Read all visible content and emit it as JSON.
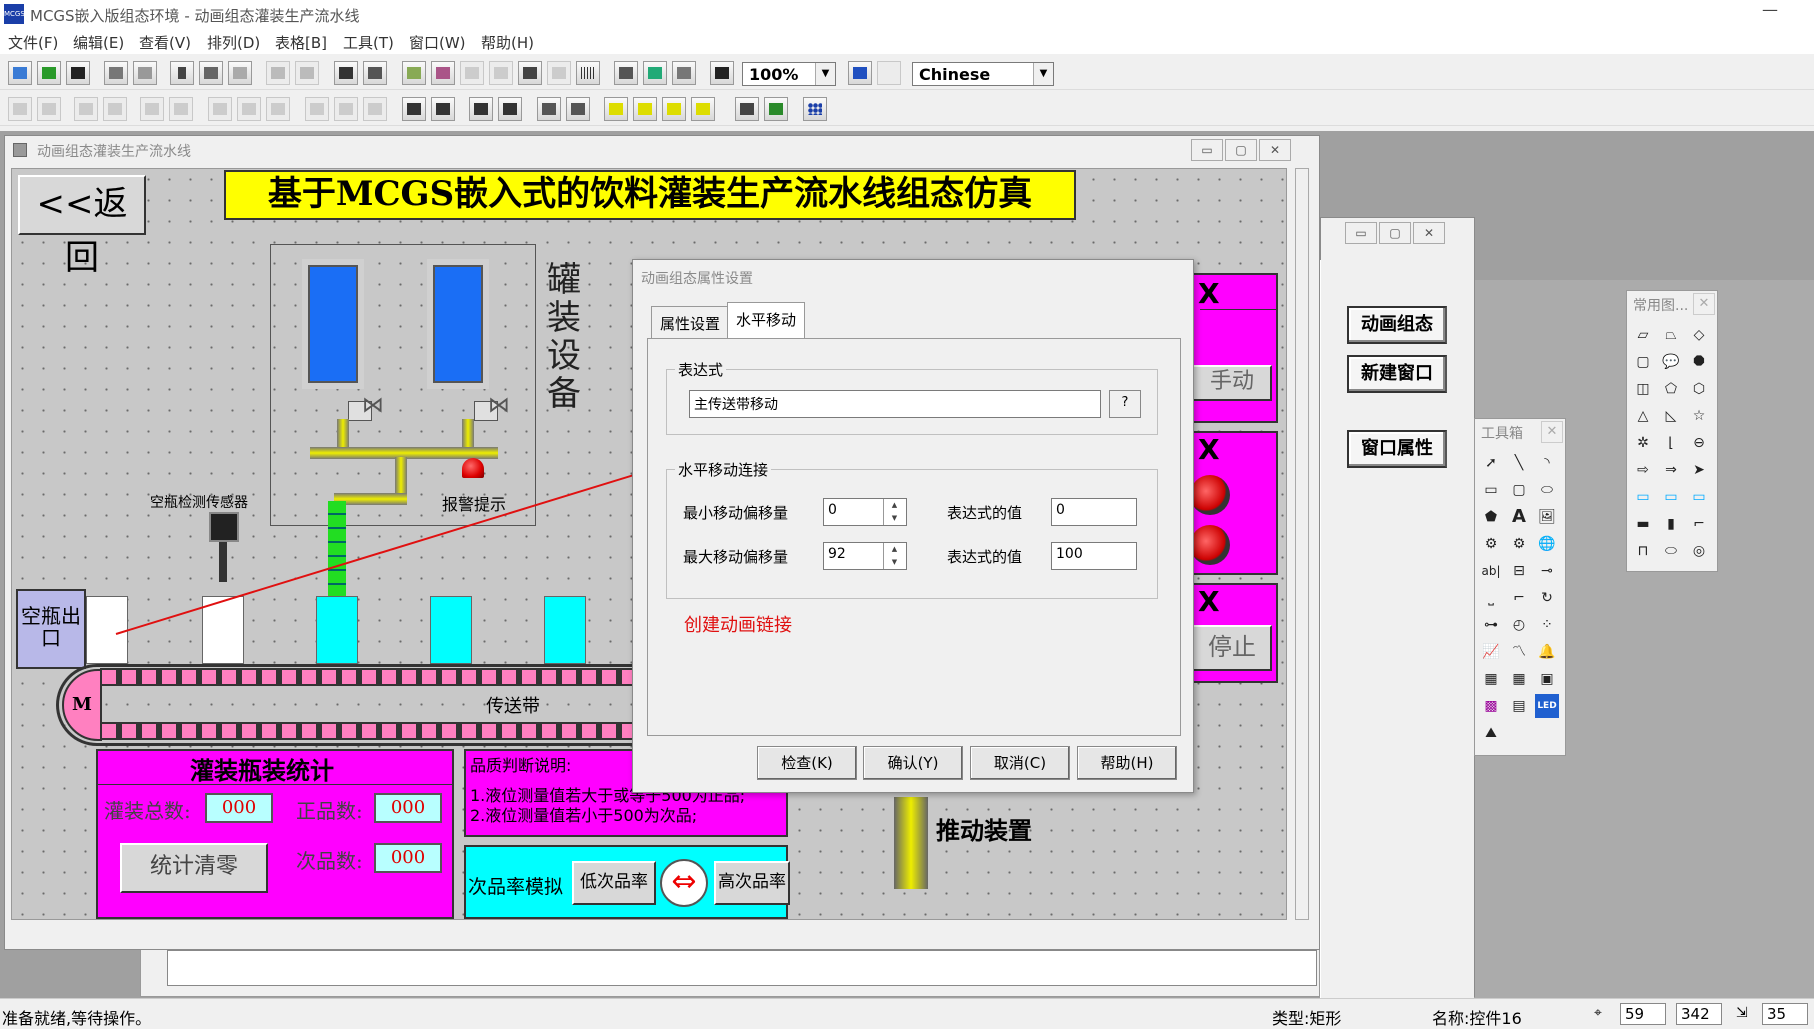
{
  "app": {
    "title": "MCGS嵌入版组态环境 - 动画组态灌装生产流水线",
    "icon_text": "MCGS"
  },
  "menu": [
    "文件(F)",
    "编辑(E)",
    "查看(V)",
    "排列(D)",
    "表格[B]",
    "工具(T)",
    "窗口(W)",
    "帮助(H)"
  ],
  "toolbar": {
    "zoom": "100%",
    "language": "Chinese"
  },
  "canvas_window": {
    "title": "动画组态灌装生产流水线",
    "back_button": "<<返回",
    "banner": "基于MCGS嵌入式的饮料灌装生产流水线组态仿真",
    "equipment_label": "罐装设备",
    "sensor_label": "空瓶检测传感器",
    "alarm_label": "报警提示",
    "empty_bottle_exit": "空瓶出口",
    "motor_label": "M",
    "conveyor_label": "传送带",
    "stats": {
      "title": "灌装瓶装统计",
      "total_label": "灌装总数:",
      "total_value": "000",
      "good_label": "正品数:",
      "good_value": "000",
      "defect_label": "次品数:",
      "defect_value": "000",
      "reset_button": "统计清零"
    },
    "quality": {
      "title": "品质判断说明:",
      "line1": "1.液位测量值若大于或等于500为正品;",
      "line2": "2.液位测量值若小于500为次品;"
    },
    "defect_sim": {
      "label": "次品率模拟",
      "low_button": "低次品率",
      "high_button": "高次品率"
    },
    "push_device": "推动装置",
    "right_panel": {
      "x1": "X",
      "x2": "X",
      "x3": "X",
      "manual_button": "手动",
      "stop_button": "停止"
    }
  },
  "side_window": {
    "buttons": [
      "动画组态",
      "新建窗口",
      "窗口属性"
    ]
  },
  "dialog": {
    "title": "动画组态属性设置",
    "tabs": [
      "属性设置",
      "水平移动"
    ],
    "expression_group": "表达式",
    "expression_value": "主传送带移动",
    "expression_help": "?",
    "link_group": "水平移动连接",
    "min_offset_label": "最小移动偏移量",
    "min_offset_value": "0",
    "min_expr_label": "表达式的值",
    "min_expr_value": "0",
    "max_offset_label": "最大移动偏移量",
    "max_offset_value": "92",
    "max_expr_label": "表达式的值",
    "max_expr_value": "100",
    "annotation": "创建动画链接",
    "buttons": [
      "检查(K)",
      "确认(Y)",
      "取消(C)",
      "帮助(H)"
    ]
  },
  "palette_common": {
    "title": "常用图..."
  },
  "palette_toolbox": {
    "title": "工具箱"
  },
  "status": {
    "message": "准备就绪,等待操作。",
    "type": "类型:矩形",
    "name": "名称:控件16",
    "x": "59",
    "y": "342",
    "w": "35"
  },
  "colors": {
    "accent_yellow": "#ffff00",
    "magenta": "#ff00ff",
    "cyan": "#00ffff",
    "tank_blue": "#1a6ef5",
    "arrow_red": "#e01010"
  }
}
